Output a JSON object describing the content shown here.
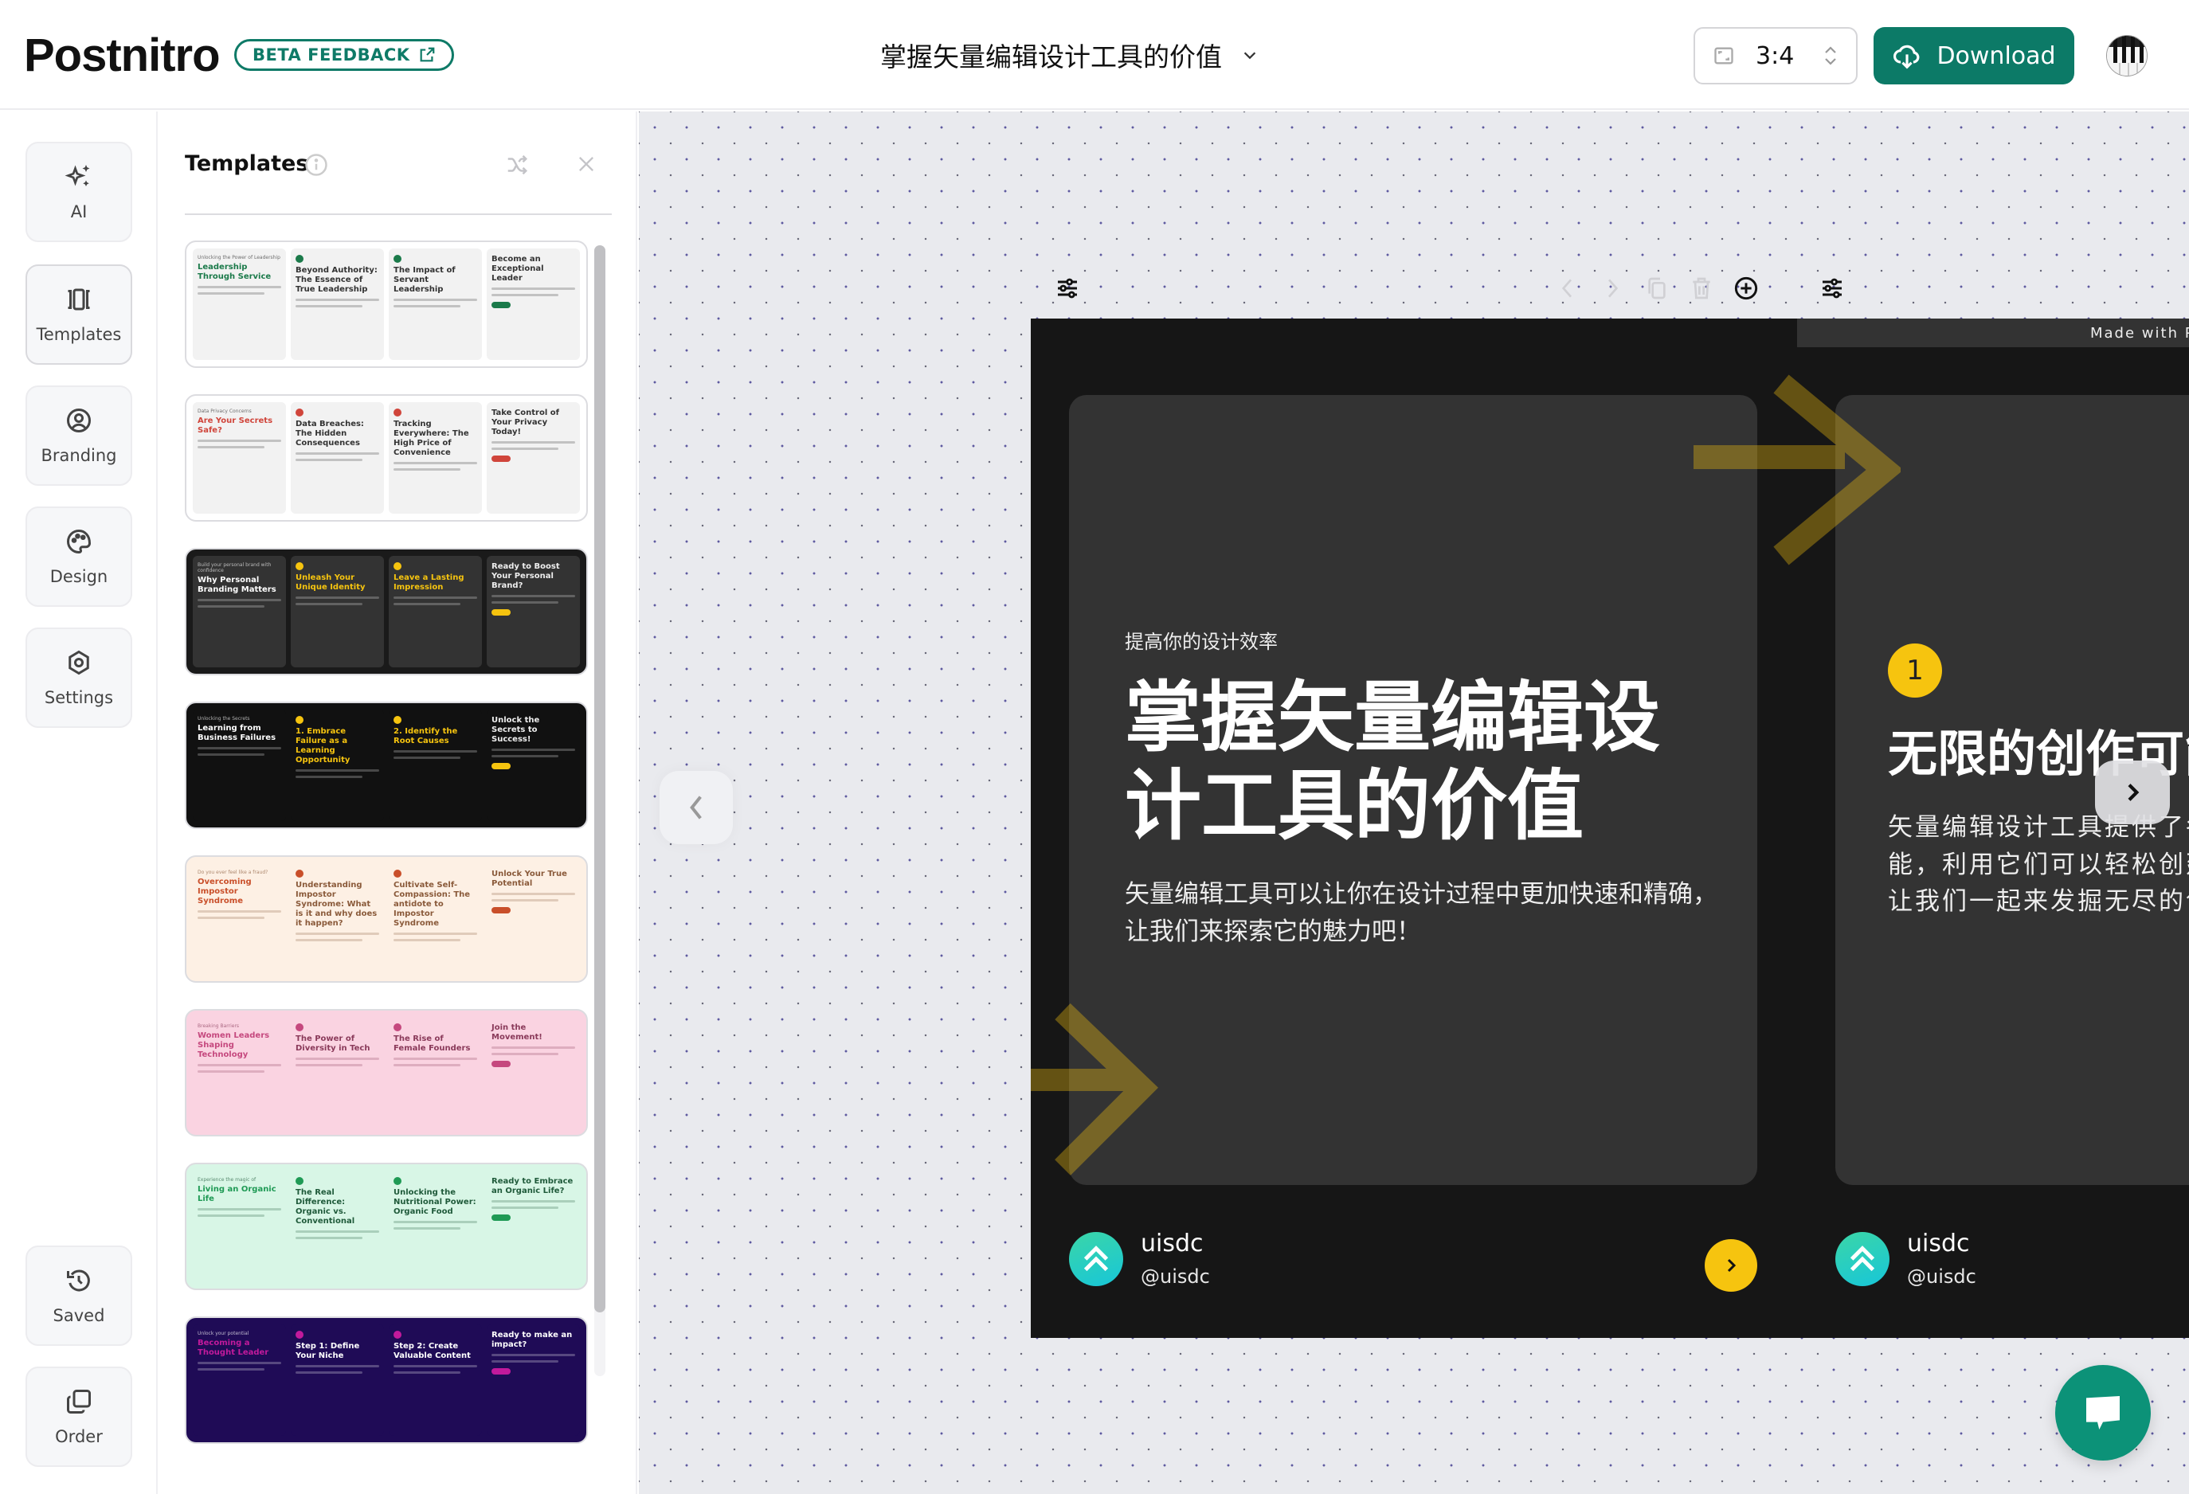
{
  "header": {
    "logo": "Postnitro",
    "beta_label": "BETA FEEDBACK",
    "doc_title": "掌握矢量编辑设计工具的价值",
    "aspect_ratio": "3:4",
    "download_label": "Download",
    "colors": {
      "brand": "#0c7a67",
      "accent": "#f6c40f"
    }
  },
  "rail": {
    "items": [
      {
        "label": "AI",
        "icon": "sparkles-icon"
      },
      {
        "label": "Templates",
        "icon": "carousel-icon",
        "active": true
      },
      {
        "label": "Branding",
        "icon": "user-circle-icon"
      },
      {
        "label": "Design",
        "icon": "palette-icon"
      },
      {
        "label": "Settings",
        "icon": "hexagon-gear-icon"
      },
      {
        "label": "Saved",
        "icon": "history-icon"
      },
      {
        "label": "Order",
        "icon": "stack-icon"
      }
    ]
  },
  "panel": {
    "title": "Templates",
    "templates": [
      {
        "theme": "light-green",
        "slides": [
          {
            "kicker": "Unlocking the Power of Leadership",
            "title": "Leadership Through Service"
          },
          {
            "title": "Beyond Authority: The Essence of True Leadership"
          },
          {
            "title": "The Impact of Servant Leadership"
          },
          {
            "title": "Become an Exceptional Leader"
          }
        ]
      },
      {
        "theme": "light-red",
        "slides": [
          {
            "kicker": "Data Privacy Concerns",
            "title": "Are Your Secrets Safe?"
          },
          {
            "title": "Data Breaches: The Hidden Consequences"
          },
          {
            "title": "Tracking Everywhere: The High Price of Convenience"
          },
          {
            "title": "Take Control of Your Privacy Today!"
          }
        ]
      },
      {
        "theme": "dark-yellow",
        "slides": [
          {
            "kicker": "Build your personal brand with confidence",
            "title": "Why Personal Branding Matters"
          },
          {
            "title": "Unleash Your Unique Identity"
          },
          {
            "title": "Leave a Lasting Impression"
          },
          {
            "title": "Ready to Boost Your Personal Brand?"
          }
        ]
      },
      {
        "theme": "black-yellow",
        "slides": [
          {
            "kicker": "Unlocking the Secrets",
            "title": "Learning from Business Failures"
          },
          {
            "title": "1. Embrace Failure as a Learning Opportunity"
          },
          {
            "title": "2. Identify the Root Causes"
          },
          {
            "title": "Unlock the Secrets to Success!"
          }
        ]
      },
      {
        "theme": "peach",
        "slides": [
          {
            "kicker": "Do you ever feel like a fraud?",
            "title": "Overcoming Impostor Syndrome"
          },
          {
            "title": "Understanding Impostor Syndrome: What is it and why does it happen?"
          },
          {
            "title": "Cultivate Self-Compassion: The antidote to Impostor Syndrome"
          },
          {
            "title": "Unlock Your True Potential"
          }
        ]
      },
      {
        "theme": "pink",
        "slides": [
          {
            "kicker": "Breaking Barriers",
            "title": "Women Leaders Shaping Technology"
          },
          {
            "title": "The Power of Diversity in Tech"
          },
          {
            "title": "The Rise of Female Founders"
          },
          {
            "title": "Join the Movement!"
          }
        ]
      },
      {
        "theme": "mint",
        "slides": [
          {
            "kicker": "Experience the magic of",
            "title": "Living an Organic Life"
          },
          {
            "title": "The Real Difference: Organic vs. Conventional"
          },
          {
            "title": "Unlocking the Nutritional Power: Organic Food"
          },
          {
            "title": "Ready to Embrace an Organic Life?"
          }
        ]
      },
      {
        "theme": "purple",
        "slides": [
          {
            "kicker": "Unlock your potential",
            "title": "Becoming a Thought Leader"
          },
          {
            "title": "Step 1: Define Your Niche"
          },
          {
            "title": "Step 2: Create Valuable Content"
          },
          {
            "title": "Ready to make an impact?"
          }
        ]
      }
    ]
  },
  "canvas": {
    "made_with": "Made with Postnitro.ai",
    "slide1": {
      "kicker": "提高你的设计效率",
      "title": "掌握矢量编辑设计工具的价值",
      "body": "矢量编辑工具可以让你在设计过程中更加快速和精确，让我们来探索它的魅力吧！"
    },
    "slide2": {
      "number": "1",
      "title": "无限的创作可能",
      "body": "矢量编辑设计工具提供了各种强大的功能，利用它们可以轻松创建复杂的图形，让我们一起来发掘无尽的创造空间！"
    },
    "author": {
      "name": "uisdc",
      "handle": "@uisdc"
    }
  }
}
